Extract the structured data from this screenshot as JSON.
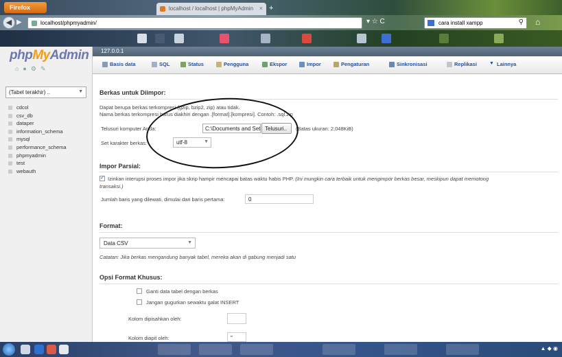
{
  "browser": {
    "button_label": "Firefox",
    "tab_title": "localhost / localhost | phpMyAdmin",
    "url": "localhost/phpmyadmin/",
    "search_text": "cara install xampp"
  },
  "sidebar": {
    "logo": {
      "php": "php",
      "my": "My",
      "admin": "Admin"
    },
    "db_select": "(Tabel terakhir) ..",
    "databases": [
      "cdcol",
      "csv_db",
      "dataper",
      "information_schema",
      "mysql",
      "performance_schema",
      "phpmyadmin",
      "test",
      "webauth"
    ]
  },
  "main": {
    "crumb": "127.0.0.1",
    "tabs": [
      "Basis data",
      "SQL",
      "Status",
      "Pengguna",
      "Ekspor",
      "Impor",
      "Pengaturan",
      "Sinkronisasi",
      "Replikasi",
      "Lainnya"
    ],
    "file_section": {
      "title": "Berkas untuk Diimpor:",
      "desc1": "Dapat berupa berkas terkompresi (gzip, bzip2, zip) atau tidak.",
      "desc2": "Nama berkas terkompresi harus diakhiri dengan .[format].[kompresi]. Contoh: .sql.zip",
      "browse_label": "Telusuri komputer Anda:",
      "file_value": "C:\\Documents and Setti",
      "browse_button": "Telusuri..",
      "max_size": "(Batas ukuran: 2,048KiB)",
      "charset_label": "Set karakter berkas:",
      "charset_value": "utf-8"
    },
    "partial_section": {
      "title": "Impor Parsial:",
      "allow_interrupt": "Izinkan interupsi proses impor jika skrip hampir mencapai batas waktu habis PHP.",
      "allow_interrupt_note": "(Ini mungkin cara terbaik untuk mengimpor berkas besar, meskipun dapat memotong",
      "allow_interrupt_note2": "transaksi.)",
      "skip_label": "Jumlah baris yang dilewati, dimulai dari baris pertama:",
      "skip_value": "0"
    },
    "format_section": {
      "title": "Format:",
      "format_value": "Data CSV",
      "note": "Catatan: Jika berkas mengandung banyak tabel, mereka akan di gabung menjadi satu"
    },
    "options_section": {
      "title": "Opsi Format Khusus:",
      "replace_label": "Ganti data tabel dengan berkas",
      "ignore_label": "Jangan gugurkan sewaktu galat INSERT",
      "separated_label": "Kolom dipisahkan oleh:",
      "enclosed_label": "Kolom diapit oleh:",
      "enclosed_value": "\""
    }
  }
}
